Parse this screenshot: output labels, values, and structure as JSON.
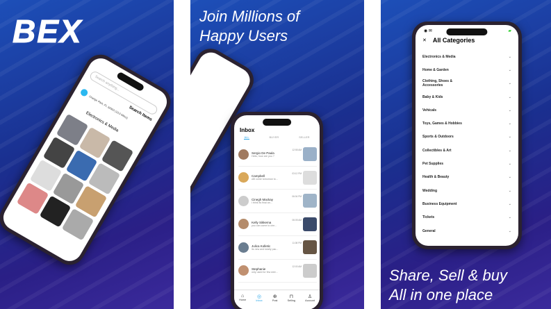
{
  "panel1": {
    "logo": "BEX",
    "search_placeholder": "Search anything...",
    "search_label": "Search Items",
    "location": "Orange Park, FL 32003 (10.0 Miles)",
    "section": "Electronics & Media"
  },
  "panel2": {
    "tagline": [
      "Join Millions of",
      "Happy Users"
    ],
    "inbox": {
      "title": "Inbox",
      "tabs": [
        "ALL",
        "BUYER",
        "SELLER"
      ],
      "messages": [
        {
          "name": "Sergio De Paula",
          "preview": "Hello, how are you ?",
          "time": "12:55 AM"
        },
        {
          "name": "Campbell",
          "preview": "will come tomorrow to...",
          "time": "03:12 PM"
        },
        {
          "name": "Cinegh Mackay",
          "preview": "I think its final an...",
          "time": "06:04 PM"
        },
        {
          "name": "Kelly Sikkema",
          "preview": "you can come to che...",
          "time": "06:05 AM"
        },
        {
          "name": "Julica Kolletic",
          "preview": "its new and totally pac...",
          "time": "11:08 PM"
        },
        {
          "name": "Stephanie",
          "preview": "only used for few wee...",
          "time": "12:00 AM"
        }
      ],
      "nav": [
        "Home",
        "Inbox",
        "Post",
        "Selling",
        "Account"
      ]
    }
  },
  "panel3": {
    "title": "All Categories",
    "categories": [
      "Electronics & Media",
      "Home & Garden",
      "Clothing, Shoes & Accessories",
      "Baby & Kids",
      "Vehicals",
      "Toys, Games & Hobbies",
      "Sports & Outdoors",
      "Collectibles & Art",
      "Pet Supplies",
      "Health & Beauty",
      "Wedding",
      "Business Equipment",
      "Tickets",
      "General"
    ],
    "tagline": [
      "Share, Sell & buy",
      "All in one place"
    ]
  }
}
